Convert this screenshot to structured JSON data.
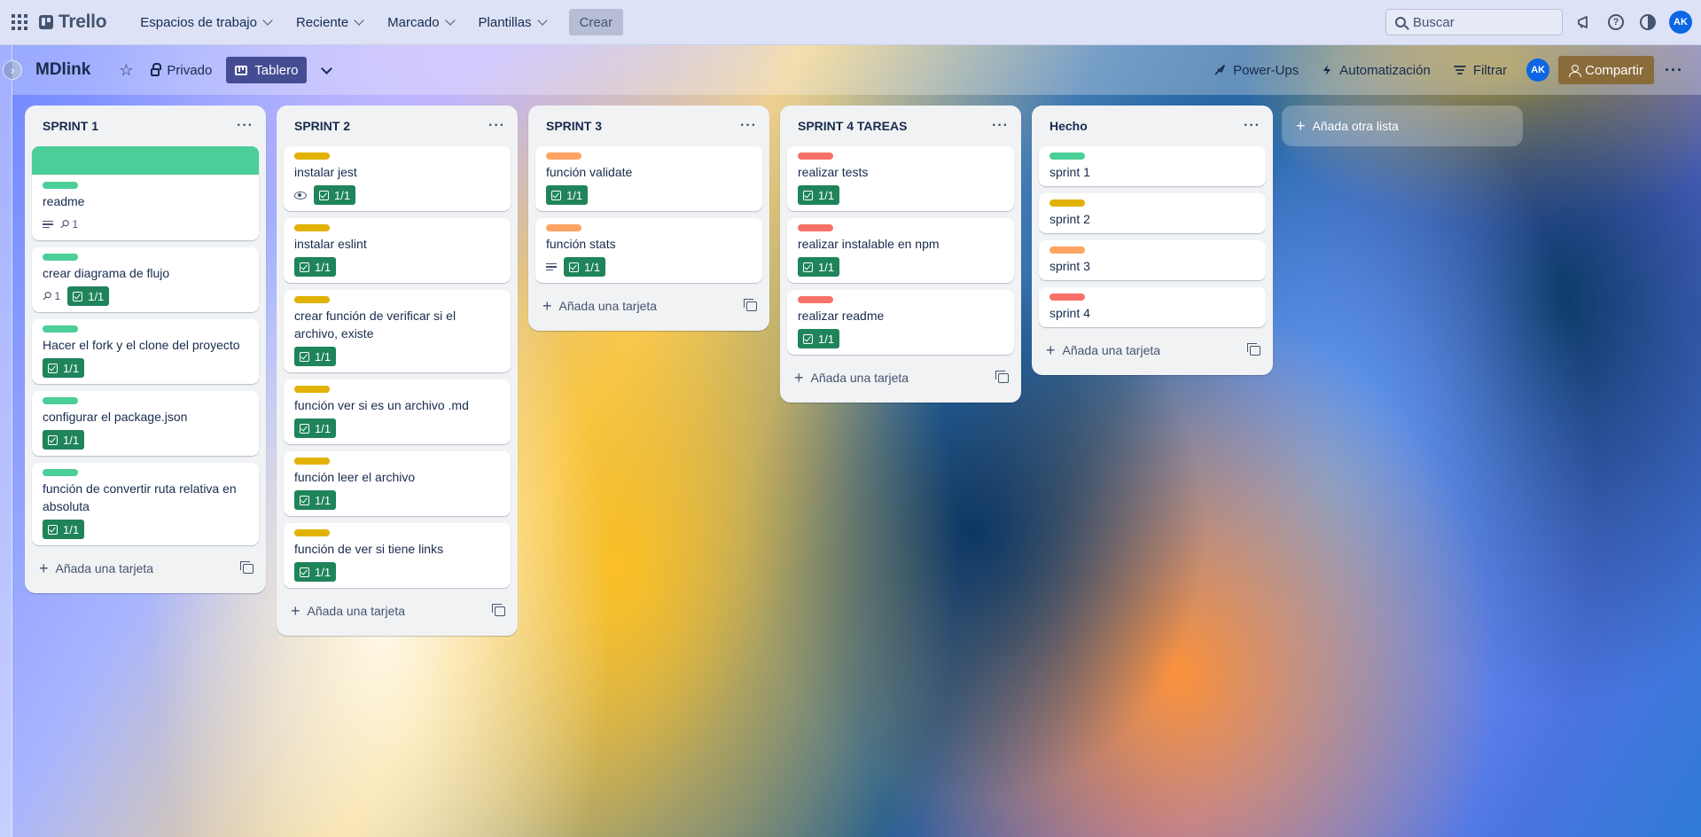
{
  "topnav": {
    "logo": "Trello",
    "menu": [
      {
        "label": "Espacios de trabajo"
      },
      {
        "label": "Reciente"
      },
      {
        "label": "Marcado"
      },
      {
        "label": "Plantillas"
      }
    ],
    "create_label": "Crear",
    "search_placeholder": "Buscar",
    "avatar_initials": "AK",
    "icons": [
      "apps-grid-icon",
      "megaphone-icon",
      "help-icon",
      "theme-icon"
    ]
  },
  "board": {
    "title": "MDlink",
    "visibility": "Privado",
    "view": "Tablero",
    "powerups": "Power-Ups",
    "automation": "Automatización",
    "filter": "Filtrar",
    "member_initials": "AK",
    "share": "Compartir",
    "add_list": "Añada otra lista",
    "add_card": "Añada una tarjeta"
  },
  "colors": {
    "green": "#4bce97",
    "yellow": "#e2b203",
    "orange": "#fea362",
    "red": "#f87168",
    "checklist_done": "#1f845a",
    "board_button": "#454c93",
    "share_button": "#8a6b3a"
  },
  "lists": [
    {
      "title": "SPRINT 1",
      "cards": [
        {
          "label": "green",
          "cover": true,
          "title": "readme",
          "description": true,
          "attachments": "1"
        },
        {
          "label": "green",
          "title": "crear diagrama de flujo",
          "attachments": "1",
          "checklist": "1/1"
        },
        {
          "label": "green",
          "title": "Hacer el fork y el clone del proyecto",
          "checklist": "1/1"
        },
        {
          "label": "green",
          "title": "configurar el package.json",
          "checklist": "1/1"
        },
        {
          "label": "green",
          "title": "función de convertir ruta relativa en absoluta",
          "checklist": "1/1"
        }
      ]
    },
    {
      "title": "SPRINT 2",
      "cards": [
        {
          "label": "yellow",
          "title": "instalar jest",
          "watching": true,
          "checklist": "1/1"
        },
        {
          "label": "yellow",
          "title": "instalar eslint",
          "checklist": "1/1"
        },
        {
          "label": "yellow",
          "title": "crear función de verificar si el archivo, existe",
          "checklist": "1/1"
        },
        {
          "label": "yellow",
          "title": "función ver si es un archivo .md",
          "checklist": "1/1"
        },
        {
          "label": "yellow",
          "title": "función leer el archivo",
          "checklist": "1/1"
        },
        {
          "label": "yellow",
          "title": "función de ver si tiene links",
          "checklist": "1/1"
        }
      ]
    },
    {
      "title": "SPRINT 3",
      "cards": [
        {
          "label": "orange",
          "title": "función validate",
          "checklist": "1/1"
        },
        {
          "label": "orange",
          "title": "función stats",
          "description": true,
          "checklist": "1/1"
        }
      ]
    },
    {
      "title": "SPRINT 4 TAREAS",
      "cards": [
        {
          "label": "red",
          "title": "realizar tests",
          "checklist": "1/1"
        },
        {
          "label": "red",
          "title": "realizar instalable en npm",
          "checklist": "1/1"
        },
        {
          "label": "red",
          "title": "realizar readme",
          "checklist": "1/1"
        }
      ]
    },
    {
      "title": "Hecho",
      "cards": [
        {
          "label": "green",
          "title": "sprint 1"
        },
        {
          "label": "yellow",
          "title": "sprint 2"
        },
        {
          "label": "orange",
          "title": "sprint 3"
        },
        {
          "label": "red",
          "title": "sprint 4"
        }
      ]
    }
  ]
}
